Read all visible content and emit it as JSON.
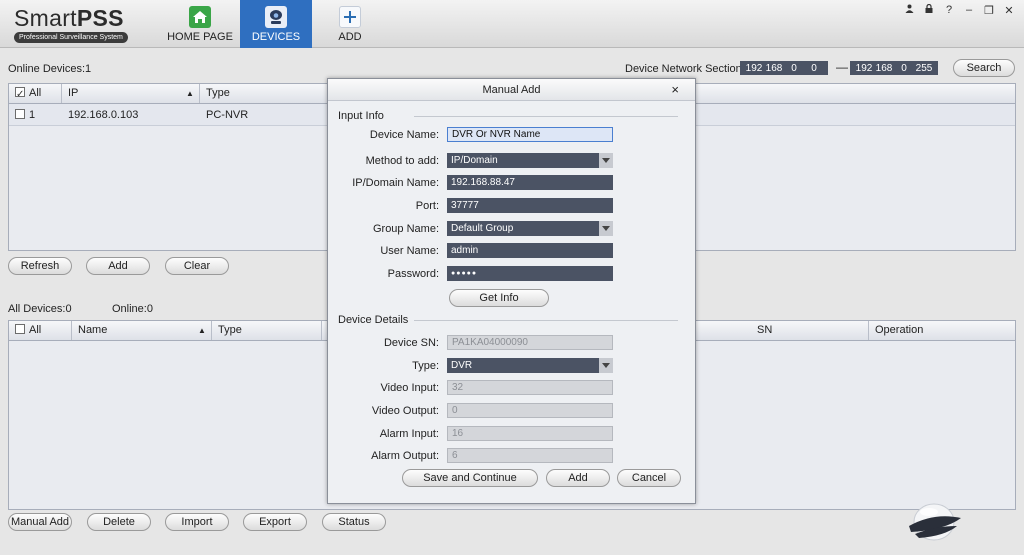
{
  "app": {
    "logo_title_a": "Smart",
    "logo_title_b": "PSS",
    "logo_subtitle": "Professional Surveillance System"
  },
  "nav": [
    {
      "label": "HOME PAGE",
      "icon": "home-icon",
      "color": "#3aa547"
    },
    {
      "label": "DEVICES",
      "icon": "camera-icon",
      "color": "#2f6fc0"
    },
    {
      "label": "ADD",
      "icon": "plus-icon",
      "color": "#2a6db3"
    }
  ],
  "window_controls": {
    "user": "▲",
    "lock": "■",
    "help": "?",
    "minimize": "–",
    "restore": "❐",
    "close": "✕"
  },
  "online": {
    "title": "Online Devices:1",
    "network_label": "Device Network Section:",
    "ip_start": [
      "192",
      "168",
      "0",
      "0"
    ],
    "ip_end": [
      "192",
      "168",
      "0",
      "255"
    ],
    "search_label": "Search",
    "columns": {
      "all": "All",
      "ip": "IP",
      "type": "Type"
    },
    "rows": [
      {
        "index": "1",
        "ip": "192.168.0.103",
        "type": "PC-NVR"
      }
    ],
    "buttons": {
      "refresh": "Refresh",
      "add": "Add",
      "clear": "Clear"
    }
  },
  "all_devices": {
    "title": "All Devices:0",
    "online": "Online:0",
    "columns": {
      "all": "All",
      "name": "Name",
      "type": "Type",
      "sn": "SN",
      "operation": "Operation"
    },
    "buttons": {
      "manual_add": "Manual Add",
      "delete": "Delete",
      "import": "Import",
      "export": "Export",
      "status": "Status"
    }
  },
  "dialog": {
    "title": "Manual Add",
    "close": "×",
    "input_section": "Input Info",
    "details_section": "Device Details",
    "fields": {
      "device_name": {
        "label": "Device Name:",
        "value": "DVR Or NVR Name"
      },
      "method": {
        "label": "Method to add:",
        "value": "IP/Domain"
      },
      "ip_domain": {
        "label": "IP/Domain Name:",
        "value": "192.168.88.47"
      },
      "port": {
        "label": "Port:",
        "value": "37777"
      },
      "group": {
        "label": "Group Name:",
        "value": "Default Group"
      },
      "user": {
        "label": "User Name:",
        "value": "admin"
      },
      "password": {
        "label": "Password:",
        "value": "●●●●●"
      }
    },
    "get_info": "Get Info",
    "details": {
      "sn": {
        "label": "Device SN:",
        "value": "PA1KA04000090"
      },
      "type": {
        "label": "Type:",
        "value": "DVR"
      },
      "video_input": {
        "label": "Video Input:",
        "value": "32"
      },
      "video_output": {
        "label": "Video Output:",
        "value": "0"
      },
      "alarm_input": {
        "label": "Alarm Input:",
        "value": "16"
      },
      "alarm_output": {
        "label": "Alarm Output:",
        "value": "6"
      }
    },
    "buttons": {
      "save_continue": "Save and Continue",
      "add": "Add",
      "cancel": "Cancel"
    }
  }
}
